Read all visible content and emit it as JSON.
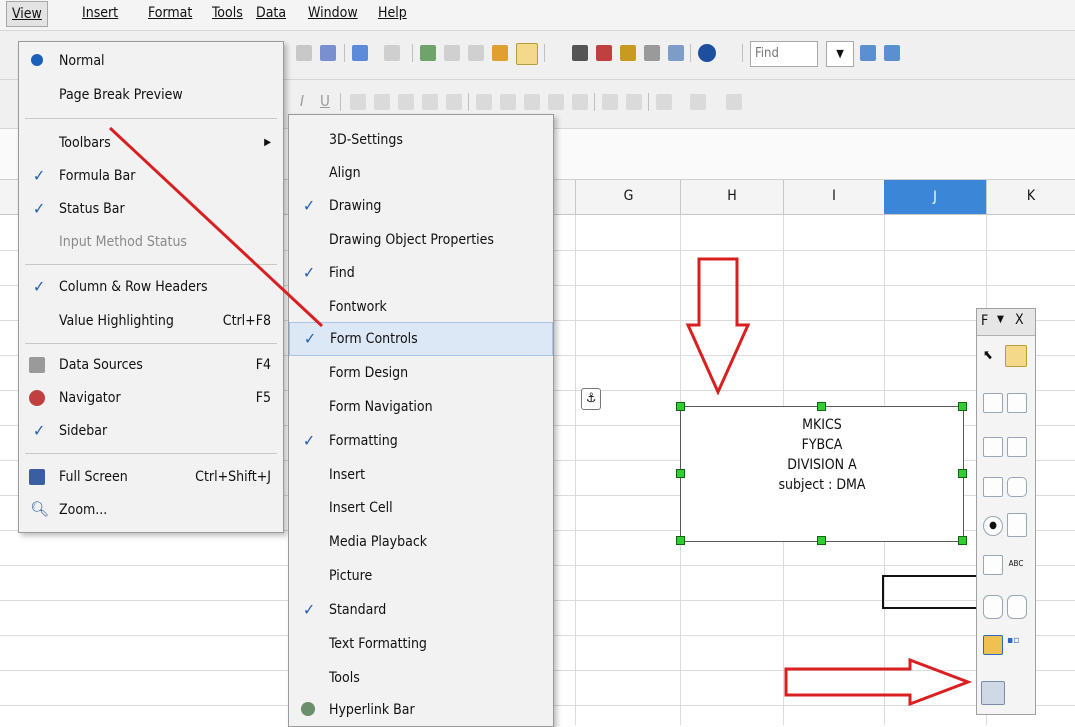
{
  "menubar": [
    "View",
    "Insert",
    "Format",
    "Tools",
    "Data",
    "Window",
    "Help"
  ],
  "toolbar": {
    "find_placeholder": "Find"
  },
  "columns": [
    "G",
    "H",
    "I",
    "J",
    "K"
  ],
  "view_menu": [
    {
      "label": "Normal",
      "mark": "radio",
      "shortcut": ""
    },
    {
      "label": "Page Break Preview",
      "mark": "",
      "shortcut": ""
    },
    {
      "label": "Toolbars",
      "mark": "",
      "shortcut": "",
      "submenu": true
    },
    {
      "label": "Formula Bar",
      "mark": "check",
      "shortcut": ""
    },
    {
      "label": "Status Bar",
      "mark": "check",
      "shortcut": ""
    },
    {
      "label": "Input Method Status",
      "mark": "",
      "shortcut": "",
      "disabled": true
    },
    {
      "label": "Column & Row Headers",
      "mark": "check",
      "shortcut": ""
    },
    {
      "label": "Value Highlighting",
      "mark": "",
      "shortcut": "Ctrl+F8"
    },
    {
      "label": "Data Sources",
      "mark": "datasource-icon",
      "shortcut": "F4"
    },
    {
      "label": "Navigator",
      "mark": "navigator-icon",
      "shortcut": "F5"
    },
    {
      "label": "Sidebar",
      "mark": "check",
      "shortcut": ""
    },
    {
      "label": "Full Screen",
      "mark": "fullscreen-icon",
      "shortcut": "Ctrl+Shift+J"
    },
    {
      "label": "Zoom...",
      "mark": "zoom-icon",
      "shortcut": ""
    }
  ],
  "toolbars_submenu": [
    {
      "label": "3D-Settings",
      "checked": false
    },
    {
      "label": "Align",
      "checked": false
    },
    {
      "label": "Drawing",
      "checked": true
    },
    {
      "label": "Drawing Object Properties",
      "checked": false
    },
    {
      "label": "Find",
      "checked": true
    },
    {
      "label": "Fontwork",
      "checked": false
    },
    {
      "label": "Form Controls",
      "checked": true,
      "highlighted": true
    },
    {
      "label": "Form Design",
      "checked": false
    },
    {
      "label": "Form Navigation",
      "checked": false
    },
    {
      "label": "Formatting",
      "checked": true
    },
    {
      "label": "Insert",
      "checked": false
    },
    {
      "label": "Insert Cell",
      "checked": false
    },
    {
      "label": "Media Playback",
      "checked": false
    },
    {
      "label": "Picture",
      "checked": false
    },
    {
      "label": "Standard",
      "checked": true
    },
    {
      "label": "Text Formatting",
      "checked": false
    },
    {
      "label": "Tools",
      "checked": false
    },
    {
      "label": "Hyperlink Bar",
      "checked": false,
      "icon": "hyperlink-icon"
    }
  ],
  "textbox": {
    "lines": [
      "MKICS",
      "FYBCA",
      "DIVISION A",
      "subject : DMA"
    ]
  },
  "form_toolbar": {
    "title": "F",
    "close": "X"
  },
  "colors": {
    "arrow": "#d91f1f",
    "accent": "#1d5fb8",
    "selected_col": "#3b86d6"
  }
}
